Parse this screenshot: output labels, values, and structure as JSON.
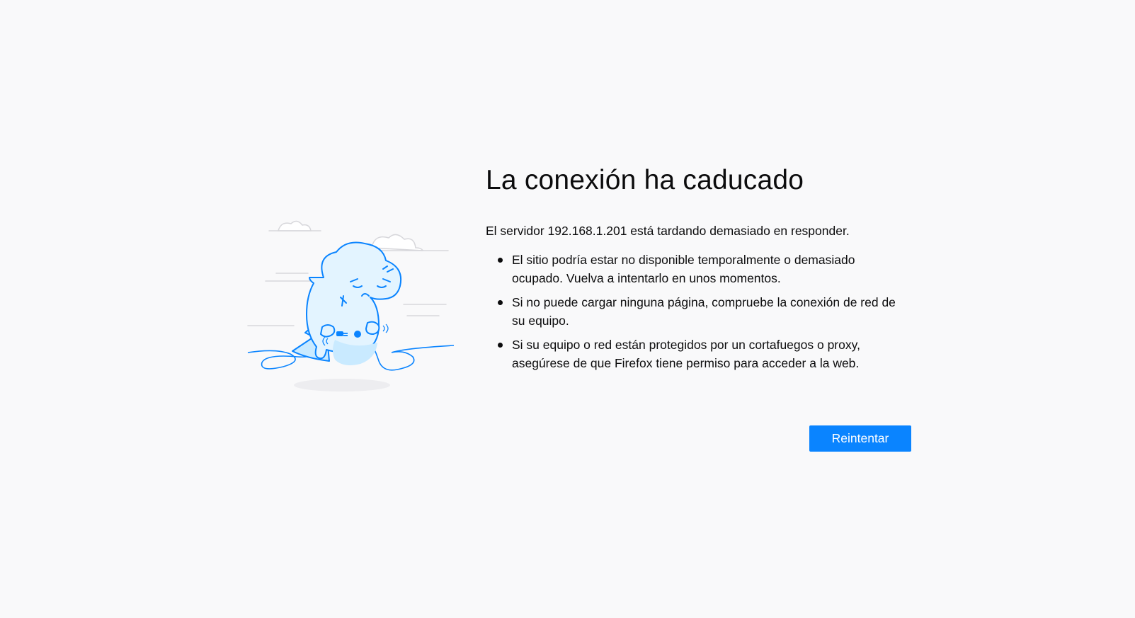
{
  "error": {
    "title": "La conexión ha caducado",
    "intro": "El servidor 192.168.1.201 está tardando demasiado en responder.",
    "reasons": [
      "El sitio podría estar no disponible temporalmente o demasiado ocupado. Vuelva a intentarlo en unos momentos.",
      "Si no puede cargar ninguna página, compruebe la conexión de red de su equipo.",
      "Si su equipo o red están protegidos por un cortafuegos o proxy, asegúrese de que Firefox tiene permiso para acceder a la web."
    ],
    "retry_label": "Reintentar"
  },
  "illustration": {
    "icon": "unplugged-dinosaur-illustration",
    "accent_color": "#0a84ff"
  },
  "colors": {
    "background": "#f9f9fa",
    "button": "#0a84ff",
    "text": "#0c0c0d"
  }
}
